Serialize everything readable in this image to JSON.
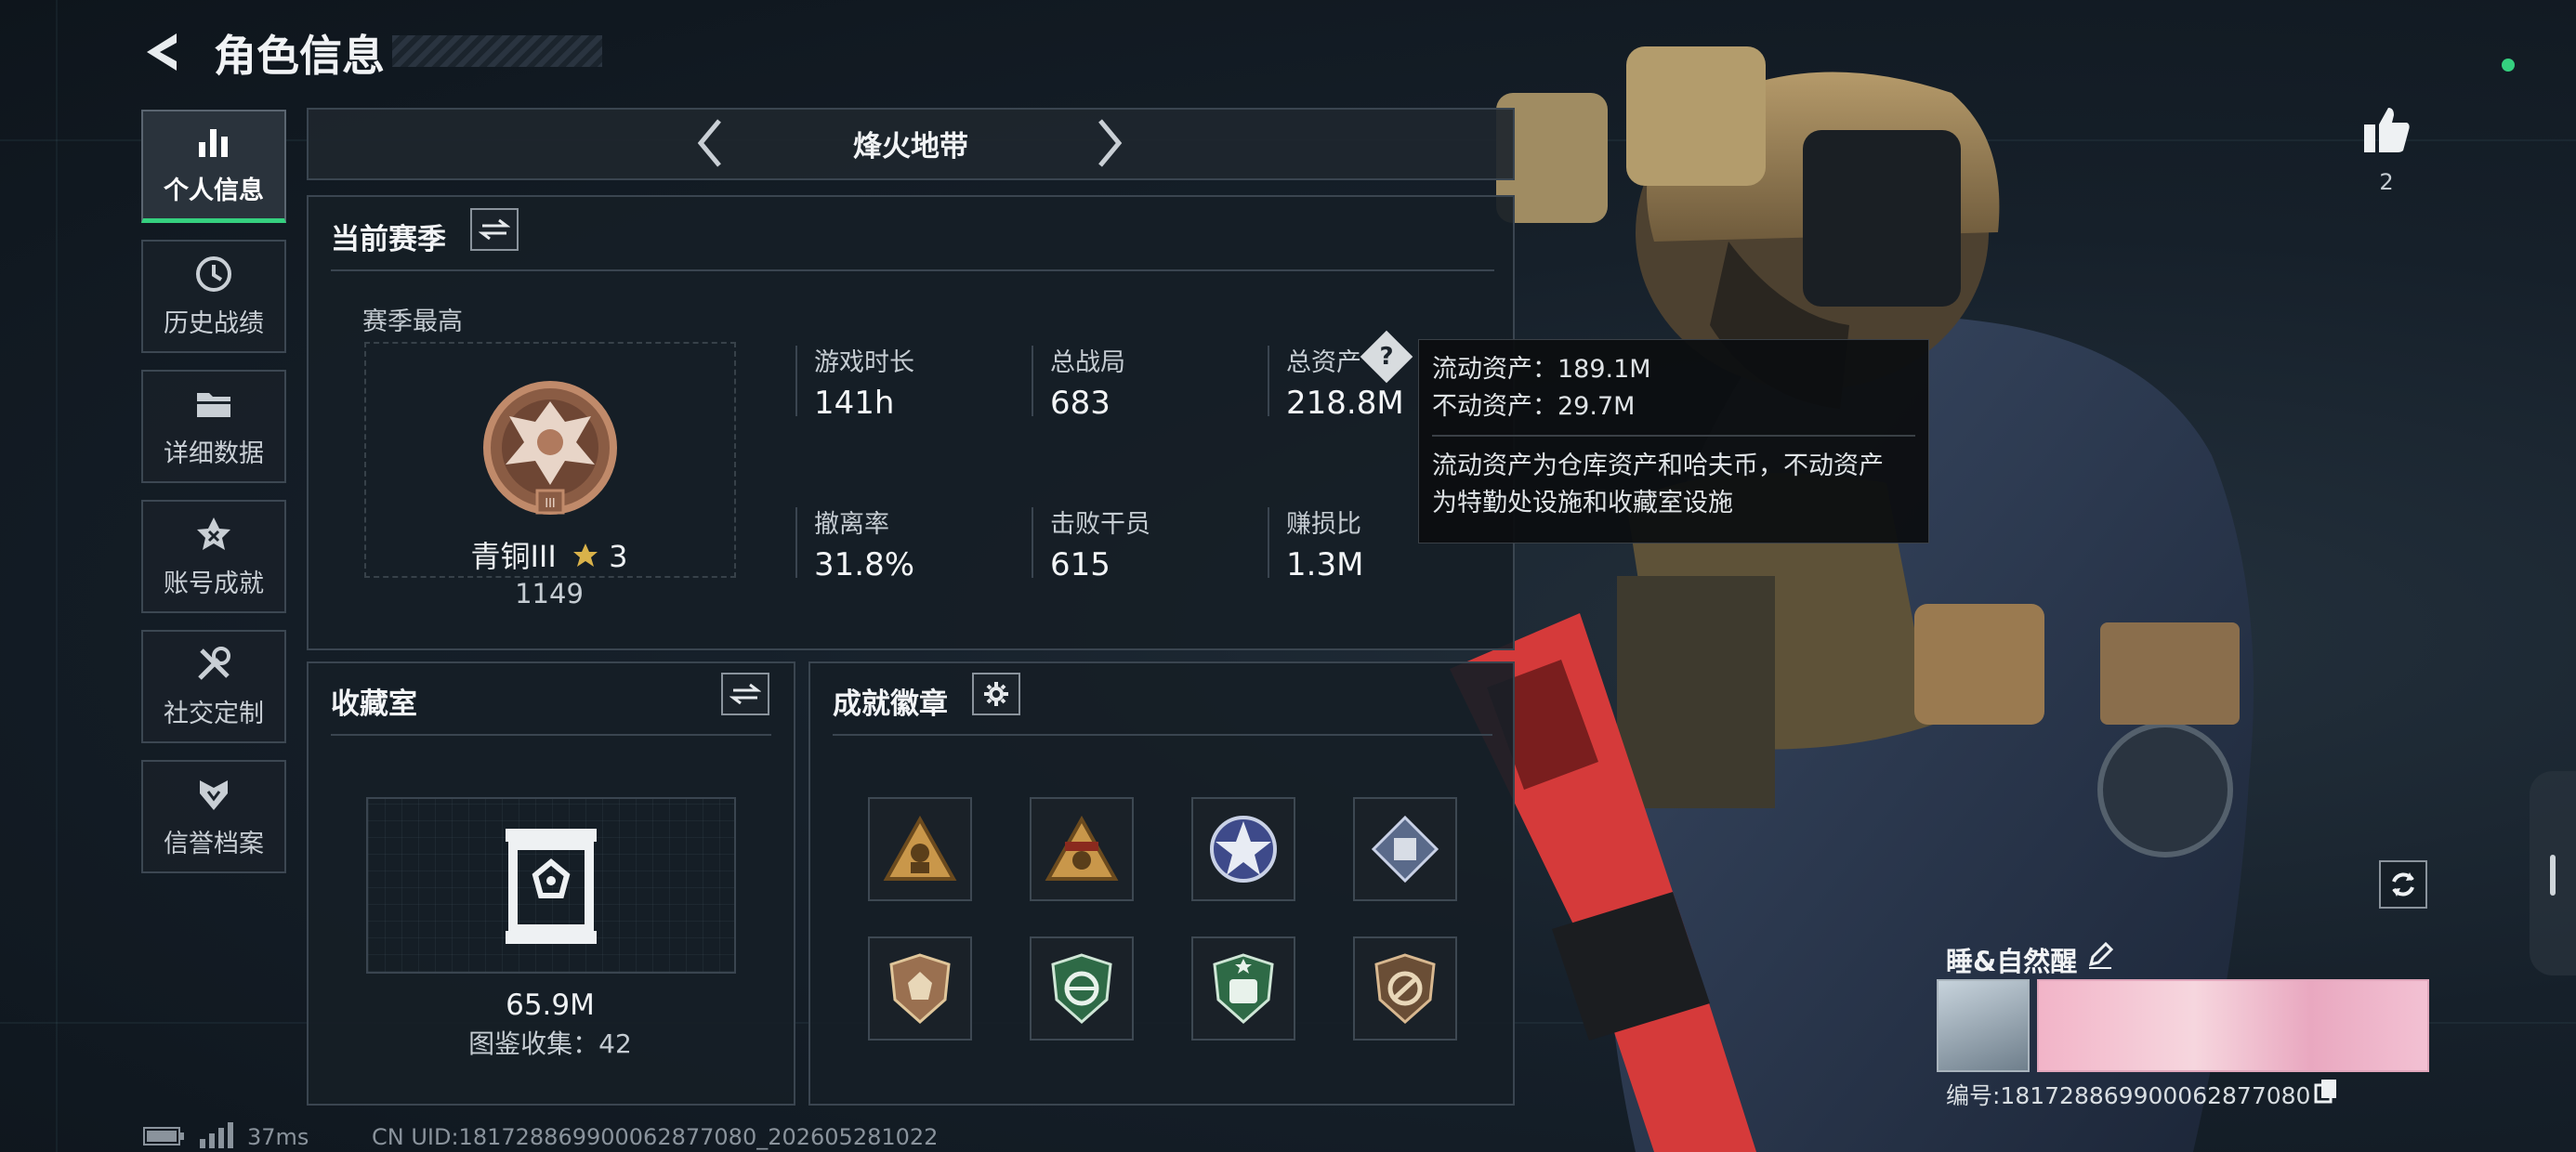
{
  "header": {
    "title": "角色信息"
  },
  "sidebar": {
    "items": [
      {
        "label": "个人信息",
        "icon": "bar-chart-icon",
        "active": true
      },
      {
        "label": "历史战绩",
        "icon": "clock-icon",
        "active": false
      },
      {
        "label": "详细数据",
        "icon": "folder-icon",
        "active": false
      },
      {
        "label": "账号成就",
        "icon": "achievement-star-icon",
        "active": false
      },
      {
        "label": "社交定制",
        "icon": "tools-icon",
        "active": false
      },
      {
        "label": "信誉档案",
        "icon": "shield-credit-icon",
        "active": false
      }
    ]
  },
  "mode_selector": {
    "label": "烽火地带"
  },
  "season": {
    "title": "当前赛季",
    "best_label": "赛季最高",
    "rank_name": "青铜III",
    "rank_stars": "3",
    "rank_score": "1149",
    "stats": [
      {
        "label": "游戏时长",
        "value": "141h"
      },
      {
        "label": "总战局",
        "value": "683"
      },
      {
        "label": "总资产",
        "value": "218.8M"
      },
      {
        "label": "撤离率",
        "value": "31.8%"
      },
      {
        "label": "击败干员",
        "value": "615"
      },
      {
        "label": "赚损比",
        "value": "1.3M"
      }
    ],
    "help_icon": "?"
  },
  "tooltip": {
    "liquid": "流动资产：189.1M",
    "fixed": "不动资产：29.7M",
    "desc_line1": "流动资产为仓库资产和哈夫币，不动资产",
    "desc_line2": "为特勤处设施和收藏室设施"
  },
  "collection": {
    "title": "收藏室",
    "value": "65.9M",
    "catalog": "图鉴收集：42"
  },
  "badges": {
    "title": "成就徽章",
    "items": [
      "triangle-soldier-badge",
      "triangle-skull-badge",
      "star-emblem-badge",
      "diamond-crate-badge",
      "bronze-shield-badge",
      "green-shield-arrows-badge",
      "green-star-shield-badge",
      "bronze-no-weapon-badge"
    ]
  },
  "player": {
    "name": "睡&自然醒",
    "id_line": "编号:18172886990006287708​0",
    "likes": "2"
  },
  "status_bar": {
    "ping": "37ms",
    "uid": "CN UID:18172886990006287708​0_202605281022"
  },
  "colors": {
    "accent_green": "#35d07f",
    "panel_border": "#3a4550",
    "background": "#111820"
  }
}
